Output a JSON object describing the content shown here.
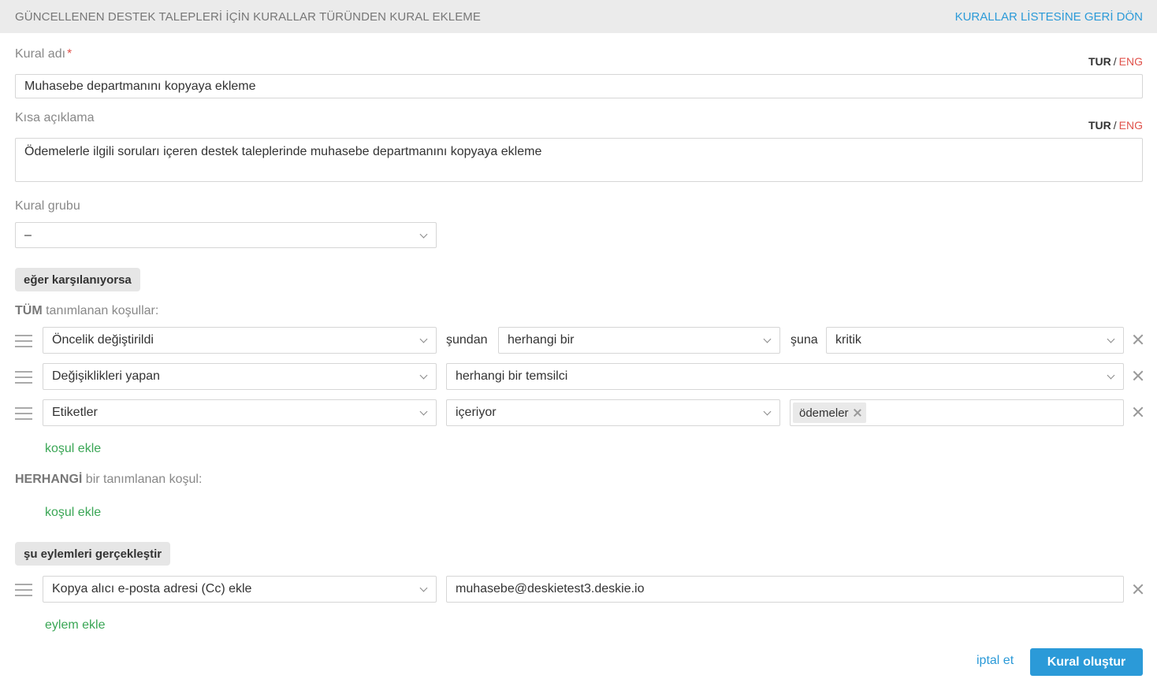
{
  "header": {
    "title": "GÜNCELLENEN DESTEK TALEPLERİ İÇİN KURALLAR TÜRÜNDEN KURAL EKLEME",
    "back_link": "KURALLAR LİSTESİNE GERİ DÖN"
  },
  "form": {
    "rule_name": {
      "label": "Kural adı",
      "required_mark": "*",
      "value": "Muhasebe departmanını kopyaya ekleme",
      "lang_tur": "TUR",
      "lang_sep": "/",
      "lang_eng": "ENG"
    },
    "short_desc": {
      "label": "Kısa açıklama",
      "value": "Ödemelerle ilgili soruları içeren destek taleplerinde muhasebe departmanını kopyaya ekleme",
      "lang_tur": "TUR",
      "lang_sep": "/",
      "lang_eng": "ENG"
    },
    "rule_group": {
      "label": "Kural grubu",
      "value": "–"
    }
  },
  "conditions": {
    "section_label": "eğer karşılanıyorsa",
    "all": {
      "label_bold": "TÜM",
      "label_rest": " tanımlanan koşullar:",
      "rows": [
        {
          "field": "Öncelik değiştirildi",
          "from_word": "şundan",
          "from_value": "herhangi bir",
          "to_word": "şuna",
          "to_value": "kritik"
        },
        {
          "field": "Değişiklikleri yapan",
          "value": "herhangi bir temsilci"
        },
        {
          "field": "Etiketler",
          "operator": "içeriyor",
          "tags": [
            "ödemeler"
          ]
        }
      ],
      "add_link": "koşul ekle"
    },
    "any": {
      "label_bold": "HERHANGİ",
      "label_rest": " bir tanımlanan koşul:",
      "add_link": "koşul ekle"
    }
  },
  "actions": {
    "section_label": "şu eylemleri gerçekleştir",
    "rows": [
      {
        "action": "Kopya alıcı e-posta adresi (Cc) ekle",
        "value": "muhasebe@deskietest3.deskie.io"
      }
    ],
    "add_link": "eylem ekle"
  },
  "footer": {
    "cancel": "iptal et",
    "submit": "Kural oluştur"
  },
  "colors": {
    "accent": "#2b9ad8",
    "link_green": "#3aa655",
    "required_red": "#e0524b",
    "header_bg": "#ebebeb"
  }
}
